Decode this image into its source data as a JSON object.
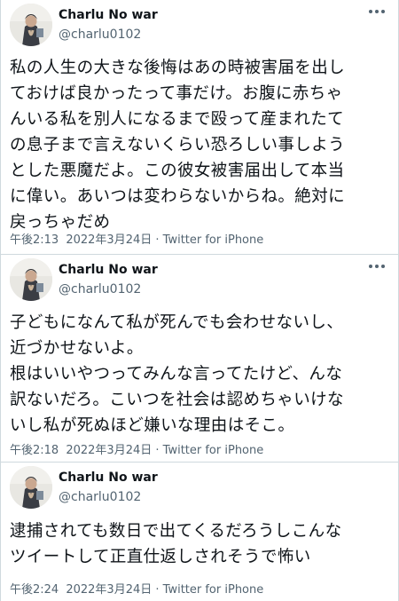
{
  "tweets": [
    {
      "display_name": "Charlu No war",
      "handle": "@charlu0102",
      "text": "私の人生の大きな後悔はあの時被害届を出し\nておけば良かったって事だけ。お腹に赤ちゃ\nんいる私を別人になるまで殴って産まれたて\nの息子まで言えないくらい恐ろしい事しよう\nとした悪魔だよ。この彼女被害届出して本当\nに偉い。あいつは変わらないからね。絶対に\n戻っちゃだめ",
      "time": "午後2:13",
      "date": "2022年3月24日",
      "client": "Twitter for iPhone"
    },
    {
      "display_name": "Charlu No war",
      "handle": "@charlu0102",
      "text": "子どもになんて私が死んでも会わせないし、\n近づかせないよ。\n根はいいやつってみんな言ってたけど、んな\n訳ないだろ。こいつを社会は認めちゃいけな\nいし私が死ぬほど嫌いな理由はそこ。",
      "time": "午後2:18",
      "date": "2022年3月24日",
      "client": "Twitter for iPhone"
    },
    {
      "display_name": "Charlu No war",
      "handle": "@charlu0102",
      "text": "逮捕されても数日で出てくるだろうしこんな\nツイートして正直仕返しされそうで怖い",
      "time": "午後2:24",
      "date": "2022年3月24日",
      "client": "Twitter for iPhone"
    }
  ],
  "separator": " · ",
  "icons": {
    "more": "more-options-icon",
    "avatar": "avatar"
  },
  "colors": {
    "text": "#0f1419",
    "secondary": "#536471",
    "border": "#cfd9de"
  }
}
